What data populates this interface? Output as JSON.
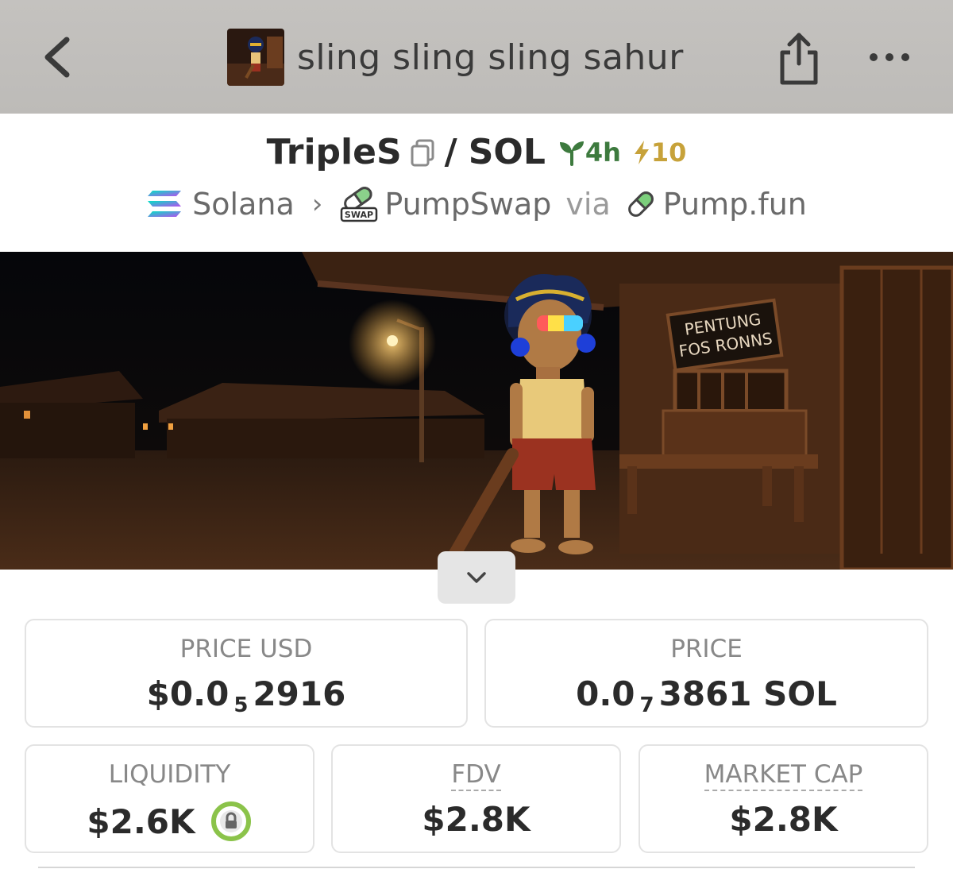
{
  "header": {
    "title": "sling sling sling sahur"
  },
  "pair": {
    "base": "TripleS",
    "separator": "/",
    "quote": "SOL",
    "age": "4h",
    "boosts": "10"
  },
  "chain": {
    "network": "Solana",
    "dex": "PumpSwap",
    "via": "via",
    "launchpad": "Pump.fun",
    "swap_badge": "SWAP"
  },
  "banner": {
    "sign_line1": "PENTUNG",
    "sign_line2": "FOS RONNS"
  },
  "stats": {
    "price_usd_label": "PRICE USD",
    "price_usd_prefix": "$0.0",
    "price_usd_zeros": "5",
    "price_usd_digits": "2916",
    "price_label": "PRICE",
    "price_prefix": "0.0",
    "price_zeros": "7",
    "price_digits": "3861 SOL",
    "liquidity_label": "LIQUIDITY",
    "liquidity_value": "$2.6K",
    "fdv_label": "FDV",
    "fdv_value": "$2.8K",
    "mcap_label": "MARKET CAP",
    "mcap_value": "$2.8K"
  },
  "colors": {
    "age_green": "#3d7a3e",
    "boost_gold": "#c7a23a",
    "lock_green": "#8bc34a"
  }
}
